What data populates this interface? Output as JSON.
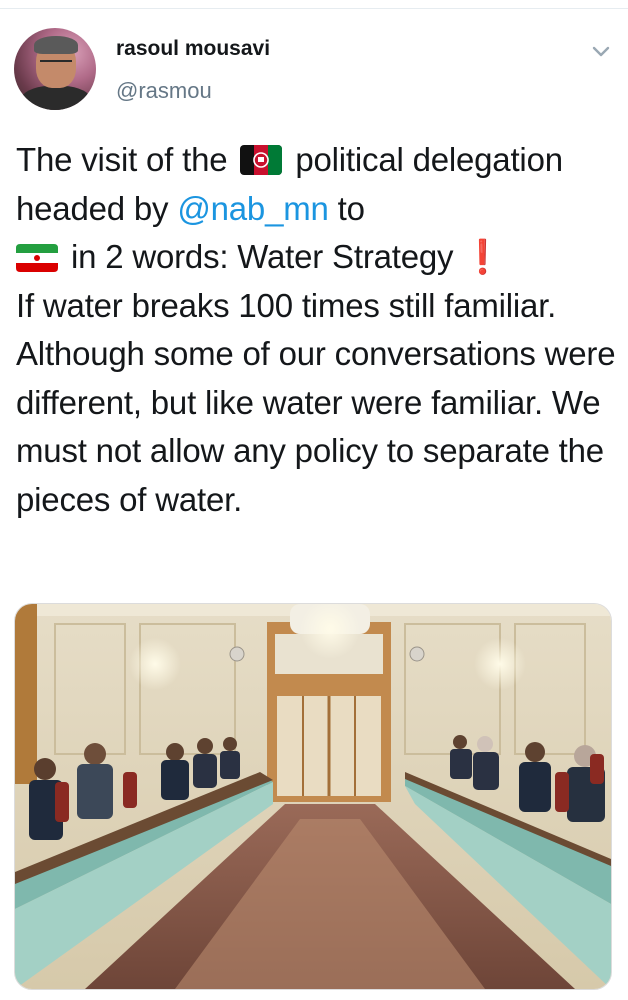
{
  "tweet": {
    "author": {
      "display_name": "rasoul mousavi",
      "handle": "@rasmou"
    },
    "text": {
      "part1": "The visit of the",
      "flag1": "afghanistan-flag-icon",
      "part2": "political delegation headed by",
      "mention": "@nab_mn",
      "part3": "to",
      "flag2": "iran-flag-icon",
      "part4": "in 2 words: Water Strategy",
      "exclaim": "❗",
      "part5": "If water breaks 100 times still familiar. Although some of our conversations were different, but like water were familiar. We must not allow any policy to separate the pieces of water."
    },
    "menu_icon": "chevron-down-icon",
    "photo": "meeting-room-photo"
  },
  "colors": {
    "mention": "#1b95e0",
    "handle": "#657786",
    "text": "#14171a"
  }
}
